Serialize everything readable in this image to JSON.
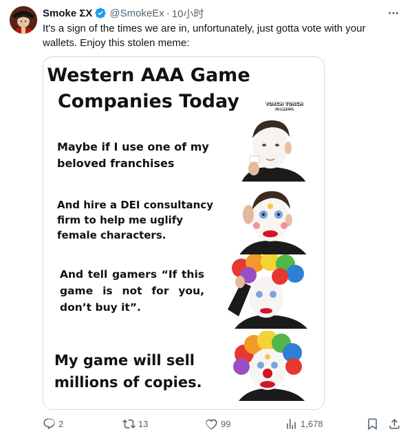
{
  "tweet": {
    "author": {
      "display_name": "Smoke ΣΧ",
      "handle": "@SmokeEx",
      "verified": true,
      "avatar_icon": "avatar-icon"
    },
    "separator": "·",
    "time": "10小时",
    "text": "It's a sign of the times we are in, unfortunately, just gotta vote with your wallets. Enjoy this stolen meme:",
    "more_icon": "more-icon",
    "colors": {
      "accent": "#1d9bf0",
      "muted": "#536471",
      "border": "#cfd9de"
    }
  },
  "meme": {
    "title": "Western AAA Game Companies Today",
    "watermark": "YORCH TORCH GAMES @TRIKERRYORCH",
    "panels": [
      {
        "text": "Maybe if I use one of my beloved franchises"
      },
      {
        "text": "And hire a DEI consultancy firm to help me uglify female characters."
      },
      {
        "text": "And tell gamers “If this game is not for you, don’t buy it”."
      },
      {
        "text": "My game will sell millions of copies."
      }
    ]
  },
  "actions": {
    "replies": "2",
    "retweets": "13",
    "likes": "99",
    "views": "1,678",
    "icons": [
      "reply-icon",
      "retweet-icon",
      "like-icon",
      "views-icon",
      "bookmark-icon",
      "share-icon"
    ]
  }
}
